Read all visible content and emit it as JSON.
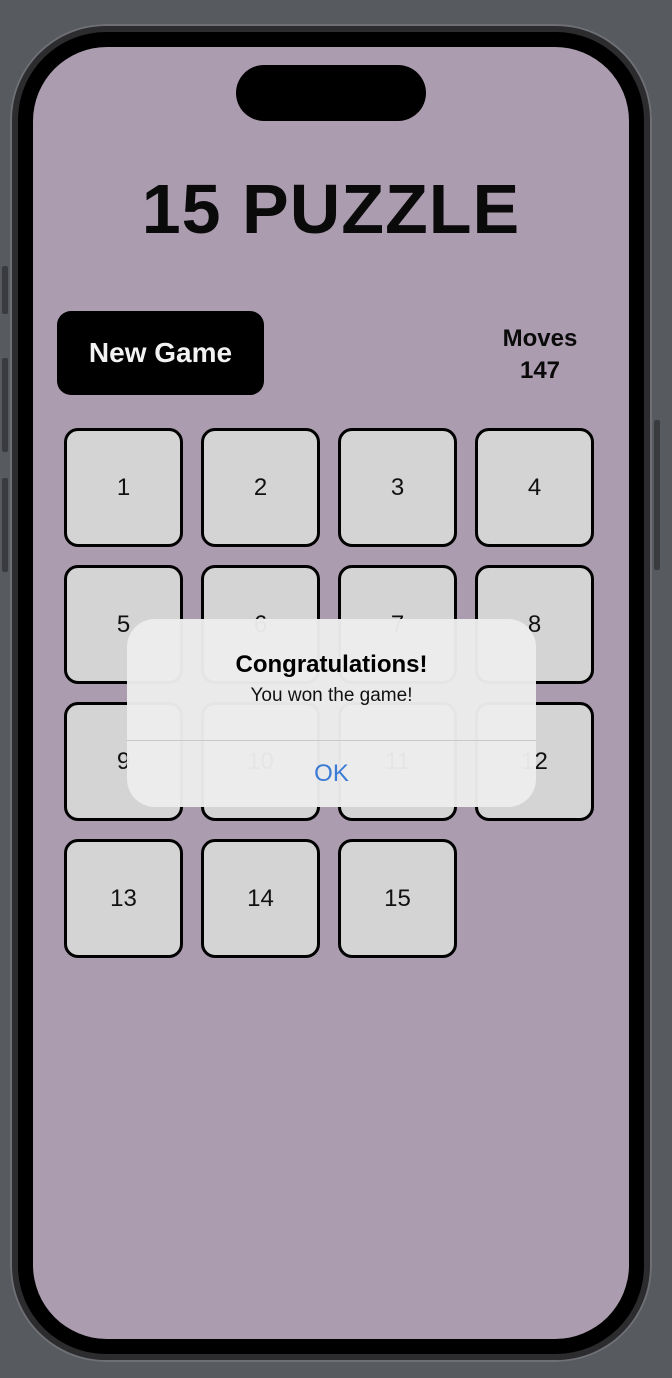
{
  "game": {
    "title": "15 PUZZLE",
    "new_game_label": "New Game",
    "moves_label": "Moves",
    "moves_count": "147"
  },
  "board": {
    "tiles": [
      "1",
      "2",
      "3",
      "4",
      "5",
      "6",
      "7",
      "8",
      "9",
      "10",
      "11",
      "12",
      "13",
      "14",
      "15",
      ""
    ]
  },
  "alert": {
    "title": "Congratulations!",
    "message": "You won the game!",
    "ok_label": "OK"
  },
  "colors": {
    "screen_background": "#ac9caf",
    "tile_fill": "#d4d4d4",
    "button_fill": "#000000",
    "alert_accent": "#3a7bd5"
  }
}
